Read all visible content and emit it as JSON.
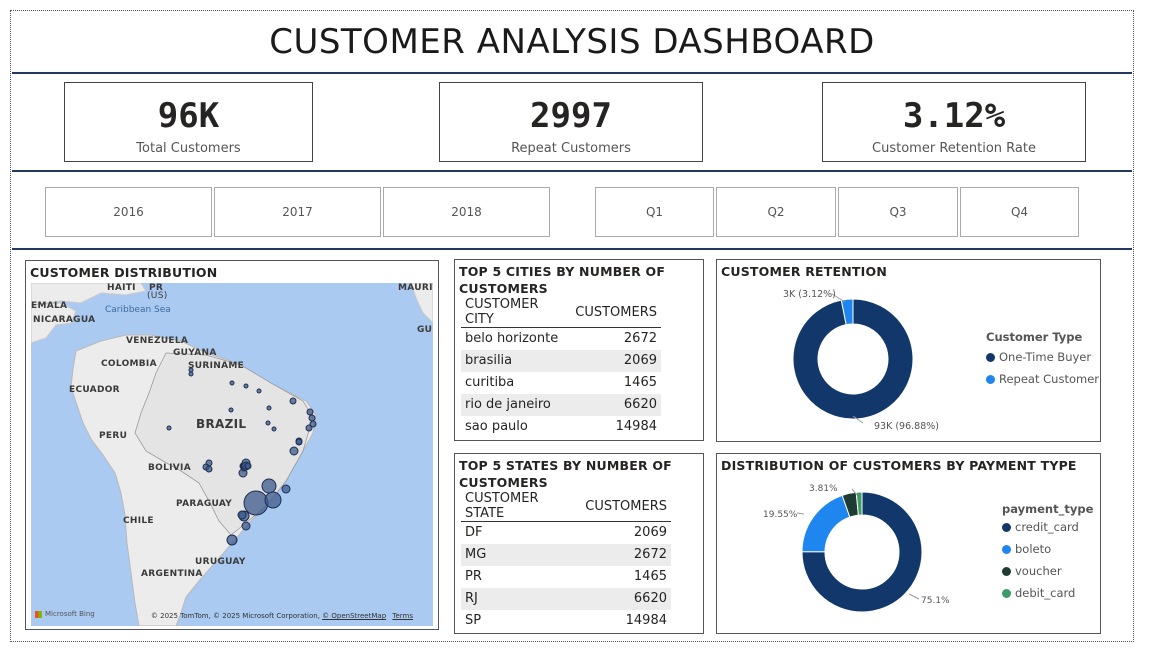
{
  "title": "CUSTOMER ANALYSIS DASHBOARD",
  "kpis": [
    {
      "value": "96K",
      "label": "Total Customers"
    },
    {
      "value": "2997",
      "label": "Repeat Customers"
    },
    {
      "value": "3.12%",
      "label": "Customer Retention Rate"
    }
  ],
  "year_slicer": [
    "2016",
    "2017",
    "2018"
  ],
  "quarter_slicer": [
    "Q1",
    "Q2",
    "Q3",
    "Q4"
  ],
  "map": {
    "title": "CUSTOMER DISTRIBUTION",
    "labels": {
      "haiti": "HAITI",
      "pr": "PR",
      "us": "(US)",
      "mauritius": "MAURIT",
      "guiana": "GUI",
      "emala": "EMALA",
      "nicaragua": "NICARAGUA",
      "caribbean": "Caribbean Sea",
      "venezuela": "VENEZUELA",
      "guyana": "GUYANA",
      "colombia": "COLOMBIA",
      "suriname": "SURINAME",
      "ecuador": "ECUADOR",
      "peru": "PERU",
      "brazil": "BRAZIL",
      "bolivia": "BOLIVIA",
      "paraguay": "PARAGUAY",
      "chile": "CHILE",
      "uruguay": "URUGUAY",
      "argentina": "ARGENTINA"
    },
    "bing": "Microsoft Bing",
    "copyright": "© 2025 TomTom, © 2025 Microsoft Corporation,",
    "osm": "© OpenStreetMap",
    "terms": "Terms"
  },
  "cities": {
    "title": "TOP 5 CITIES BY NUMBER OF CUSTOMERS",
    "headers": [
      "CUSTOMER CITY",
      "CUSTOMERS"
    ],
    "rows": [
      [
        "belo horizonte",
        "2672"
      ],
      [
        "brasilia",
        "2069"
      ],
      [
        "curitiba",
        "1465"
      ],
      [
        "rio de janeiro",
        "6620"
      ],
      [
        "sao paulo",
        "14984"
      ]
    ]
  },
  "states": {
    "title": "TOP 5 STATES BY NUMBER OF CUSTOMERS",
    "headers": [
      "CUSTOMER STATE",
      "CUSTOMERS"
    ],
    "rows": [
      [
        "DF",
        "2069"
      ],
      [
        "MG",
        "2672"
      ],
      [
        "PR",
        "1465"
      ],
      [
        "RJ",
        "6620"
      ],
      [
        "SP",
        "14984"
      ]
    ]
  },
  "retention": {
    "title": "CUSTOMER RETENTION",
    "legend_title": "Customer Type",
    "label_small": "3K (3.12%)",
    "label_big": "93K (96.88%)",
    "series": [
      {
        "name": "One-Time Buyer",
        "value": 96.88,
        "color": "#12386b"
      },
      {
        "name": "Repeat Customer",
        "value": 3.12,
        "color": "#1f86f0"
      }
    ]
  },
  "payment": {
    "title": "DISTRIBUTION OF CUSTOMERS BY PAYMENT TYPE",
    "legend_title": "payment_type",
    "label_a": "75.1%",
    "label_b": "19.55%",
    "label_c": "3.81%",
    "series": [
      {
        "name": "credit_card",
        "value": 75.1,
        "color": "#12386b"
      },
      {
        "name": "boleto",
        "value": 19.55,
        "color": "#1f86f0"
      },
      {
        "name": "voucher",
        "value": 3.81,
        "color": "#1e3b34"
      },
      {
        "name": "debit_card",
        "value": 1.54,
        "color": "#3e9b68"
      }
    ]
  },
  "chart_data": [
    {
      "type": "pie",
      "title": "CUSTOMER RETENTION",
      "categories": [
        "One-Time Buyer",
        "Repeat Customer"
      ],
      "values": [
        96.88,
        3.12
      ]
    },
    {
      "type": "pie",
      "title": "DISTRIBUTION OF CUSTOMERS BY PAYMENT TYPE",
      "categories": [
        "credit_card",
        "boleto",
        "voucher",
        "debit_card"
      ],
      "values": [
        75.1,
        19.55,
        3.81,
        1.54
      ]
    }
  ]
}
